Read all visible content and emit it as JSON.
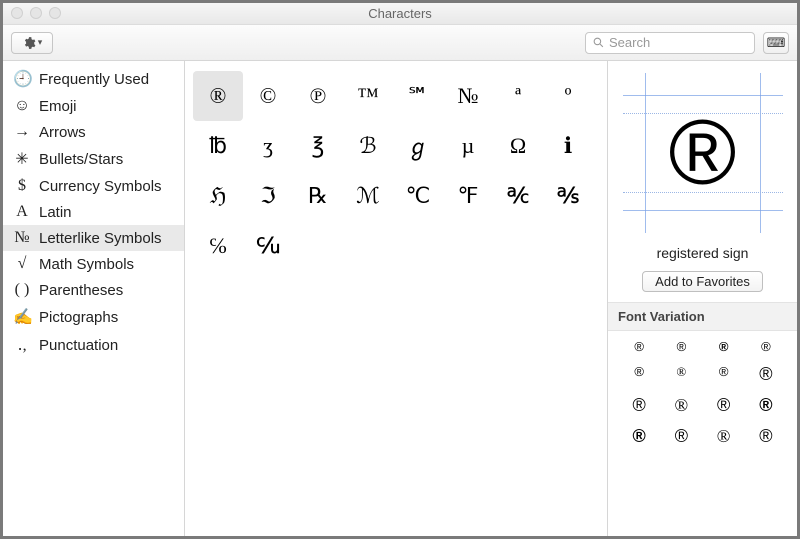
{
  "window": {
    "title": "Characters"
  },
  "toolbar": {
    "search_placeholder": "Search"
  },
  "sidebar": {
    "items": [
      {
        "icon": "🕘",
        "label": "Frequently Used"
      },
      {
        "icon": "☺",
        "label": "Emoji"
      },
      {
        "icon": "→",
        "label": "Arrows"
      },
      {
        "icon": "✳",
        "label": "Bullets/Stars"
      },
      {
        "icon": "$",
        "label": "Currency Symbols"
      },
      {
        "icon": "A",
        "label": "Latin"
      },
      {
        "icon": "№",
        "label": "Letterlike Symbols"
      },
      {
        "icon": "√",
        "label": "Math Symbols"
      },
      {
        "icon": "( )",
        "label": "Parentheses"
      },
      {
        "icon": "✍",
        "label": "Pictographs"
      },
      {
        "icon": "․,",
        "label": "Punctuation"
      }
    ],
    "selected_index": 6
  },
  "grid": {
    "selected_index": 0,
    "rows": [
      [
        "®",
        "©",
        "℗",
        "™",
        "℠",
        "№",
        "ª",
        "º"
      ],
      [
        "℔",
        "ʒ",
        "℥",
        "ℬ",
        "ℊ",
        "µ",
        "Ω",
        "ℹ"
      ],
      [
        "ℌ",
        "ℑ",
        "℞",
        "ℳ",
        "℃",
        "℉",
        "℀",
        "℁"
      ],
      [
        "℅",
        "℆"
      ]
    ]
  },
  "detail": {
    "glyph": "®",
    "name": "registered sign",
    "favorites_label": "Add to Favorites",
    "font_variation_label": "Font Variation",
    "variations": [
      "®",
      "®",
      "®",
      "®",
      "®",
      "®",
      "®",
      "®",
      "®",
      "®",
      "®",
      "®",
      "®",
      "®",
      "®",
      "®"
    ]
  }
}
